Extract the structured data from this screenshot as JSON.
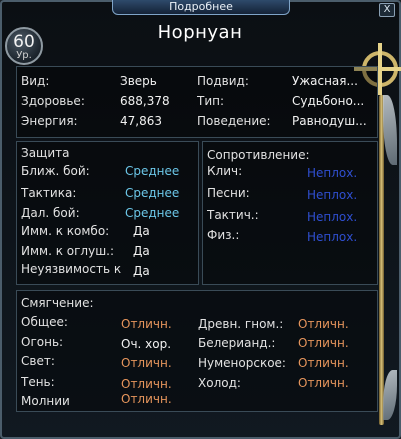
{
  "window": {
    "title": "Подробнее",
    "close_label": "X"
  },
  "level": {
    "number": "60",
    "label": "Ур."
  },
  "name": "Норнуан",
  "info": [
    {
      "label": "Вид:",
      "value": "Зверь"
    },
    {
      "label": "Здоровье:",
      "value": "688,378"
    },
    {
      "label": "Энергия:",
      "value": "47,863"
    }
  ],
  "info_right": [
    {
      "label": "Подвид:",
      "value": "Ужасная..."
    },
    {
      "label": "Тип:",
      "value": "Судьбоно..."
    },
    {
      "label": "Поведение:",
      "value": "Равнодуш..."
    }
  ],
  "defense": {
    "title": "Защита",
    "rows": [
      {
        "label": "Ближ. бой:",
        "value": "Среднее"
      },
      {
        "label": "Тактика:",
        "value": "Среднее"
      },
      {
        "label": "Дал. бой:",
        "value": "Среднее"
      },
      {
        "label": "Имм. к комбо:",
        "value": "Да"
      },
      {
        "label": "Имм. к оглуш.:",
        "value": "Да"
      },
      {
        "label": "Неуязвимость к",
        "value": "Да"
      }
    ]
  },
  "resistance": {
    "title": "Сопротивление:",
    "rows": [
      {
        "label": "Клич:",
        "value": "Неплох."
      },
      {
        "label": "Песни:",
        "value": "Неплох."
      },
      {
        "label": "Тактич.:",
        "value": "Неплох."
      },
      {
        "label": "Физ.:",
        "value": "Неплох."
      }
    ]
  },
  "mitigation": {
    "title": "Смягчение:",
    "left": [
      {
        "label": "Общее:",
        "value": "Отличн."
      },
      {
        "label": "Огонь:",
        "value": "Оч. хор."
      },
      {
        "label": "Свет:",
        "value": "Отличн."
      },
      {
        "label": "Тень:",
        "value": "Отличн."
      },
      {
        "label": "Молнии",
        "value": "Отличн."
      }
    ],
    "right": [
      {
        "label": "Древн. гном.:",
        "value": "Отличн."
      },
      {
        "label": "Белерианд.:",
        "value": "Отличн."
      },
      {
        "label": "Нуменорское:",
        "value": "Отличн."
      },
      {
        "label": "Холод:",
        "value": "Отличн."
      }
    ]
  },
  "colors": {
    "accent_blue": "#6cc7e8",
    "resist_blue": "#2f4fd0",
    "mitigation_orange": "#e6955c"
  }
}
